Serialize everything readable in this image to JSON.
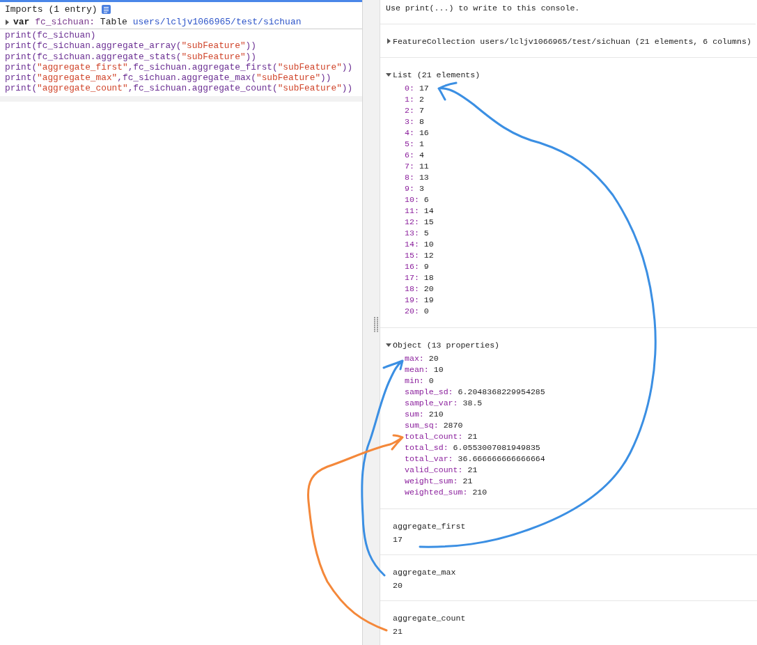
{
  "editor": {
    "imports_header": "Imports (1 entry)",
    "import": {
      "expanded": false,
      "keyword": "var",
      "name": "fc_sichuan:",
      "type": "Table",
      "path": "users/lcljv1066965/test/sichuan"
    },
    "code_lines": [
      [
        {
          "kind": "code",
          "text": "print(fc_sichuan)"
        }
      ],
      [
        {
          "kind": "code",
          "text": "print(fc_sichuan.aggregate_array("
        },
        {
          "kind": "string",
          "text": "\"subFeature\""
        },
        {
          "kind": "code",
          "text": "))"
        }
      ],
      [
        {
          "kind": "code",
          "text": "print(fc_sichuan.aggregate_stats("
        },
        {
          "kind": "string",
          "text": "\"subFeature\""
        },
        {
          "kind": "code",
          "text": "))"
        }
      ],
      [
        {
          "kind": "code",
          "text": "print("
        },
        {
          "kind": "string",
          "text": "\"aggregate_first\""
        },
        {
          "kind": "code",
          "text": ",fc_sichuan.aggregate_first("
        },
        {
          "kind": "string",
          "text": "\"subFeature\""
        },
        {
          "kind": "code",
          "text": "))"
        }
      ],
      [
        {
          "kind": "code",
          "text": "print("
        },
        {
          "kind": "string",
          "text": "\"aggregate_max\""
        },
        {
          "kind": "code",
          "text": ",fc_sichuan.aggregate_max("
        },
        {
          "kind": "string",
          "text": "\"subFeature\""
        },
        {
          "kind": "code",
          "text": "))"
        }
      ],
      [
        {
          "kind": "code",
          "text": "print("
        },
        {
          "kind": "string",
          "text": "\"aggregate_count\""
        },
        {
          "kind": "code",
          "text": ",fc_sichuan.aggregate_count("
        },
        {
          "kind": "string",
          "text": "\"subFeature\""
        },
        {
          "kind": "code",
          "text": "))"
        }
      ]
    ]
  },
  "console": {
    "hint": "Use print(...) to write to this console.",
    "entries": [
      {
        "kind": "tree",
        "label": "FeatureCollection users/lcljv1066965/test/sichuan (21 elements, 6 columns)",
        "expanded": false
      },
      {
        "kind": "tree",
        "label": "List (21 elements)",
        "expanded": true,
        "items": [
          {
            "key": "0:",
            "value": "17"
          },
          {
            "key": "1:",
            "value": "2"
          },
          {
            "key": "2:",
            "value": "7"
          },
          {
            "key": "3:",
            "value": "8"
          },
          {
            "key": "4:",
            "value": "16"
          },
          {
            "key": "5:",
            "value": "1"
          },
          {
            "key": "6:",
            "value": "4"
          },
          {
            "key": "7:",
            "value": "11"
          },
          {
            "key": "8:",
            "value": "13"
          },
          {
            "key": "9:",
            "value": "3"
          },
          {
            "key": "10:",
            "value": "6"
          },
          {
            "key": "11:",
            "value": "14"
          },
          {
            "key": "12:",
            "value": "15"
          },
          {
            "key": "13:",
            "value": "5"
          },
          {
            "key": "14:",
            "value": "10"
          },
          {
            "key": "15:",
            "value": "12"
          },
          {
            "key": "16:",
            "value": "9"
          },
          {
            "key": "17:",
            "value": "18"
          },
          {
            "key": "18:",
            "value": "20"
          },
          {
            "key": "19:",
            "value": "19"
          },
          {
            "key": "20:",
            "value": "0"
          }
        ]
      },
      {
        "kind": "tree",
        "label": "Object (13 properties)",
        "expanded": true,
        "items": [
          {
            "key": "max:",
            "value": "20"
          },
          {
            "key": "mean:",
            "value": "10"
          },
          {
            "key": "min:",
            "value": "0"
          },
          {
            "key": "sample_sd:",
            "value": "6.2048368229954285"
          },
          {
            "key": "sample_var:",
            "value": "38.5"
          },
          {
            "key": "sum:",
            "value": "210"
          },
          {
            "key": "sum_sq:",
            "value": "2870"
          },
          {
            "key": "total_count:",
            "value": "21"
          },
          {
            "key": "total_sd:",
            "value": "6.0553007081949835"
          },
          {
            "key": "total_var:",
            "value": "36.666666666666664"
          },
          {
            "key": "valid_count:",
            "value": "21"
          },
          {
            "key": "weight_sum:",
            "value": "21"
          },
          {
            "key": "weighted_sum:",
            "value": "210"
          }
        ]
      },
      {
        "kind": "pair",
        "label": "aggregate_first",
        "value": "17"
      },
      {
        "kind": "pair",
        "label": "aggregate_max",
        "value": "20"
      },
      {
        "kind": "pair",
        "label": "aggregate_count",
        "value": "21"
      }
    ]
  },
  "annotations": [
    {
      "color": "#3b8fe3"
    },
    {
      "color": "#3b8fe3"
    },
    {
      "color": "#f4883a"
    }
  ]
}
